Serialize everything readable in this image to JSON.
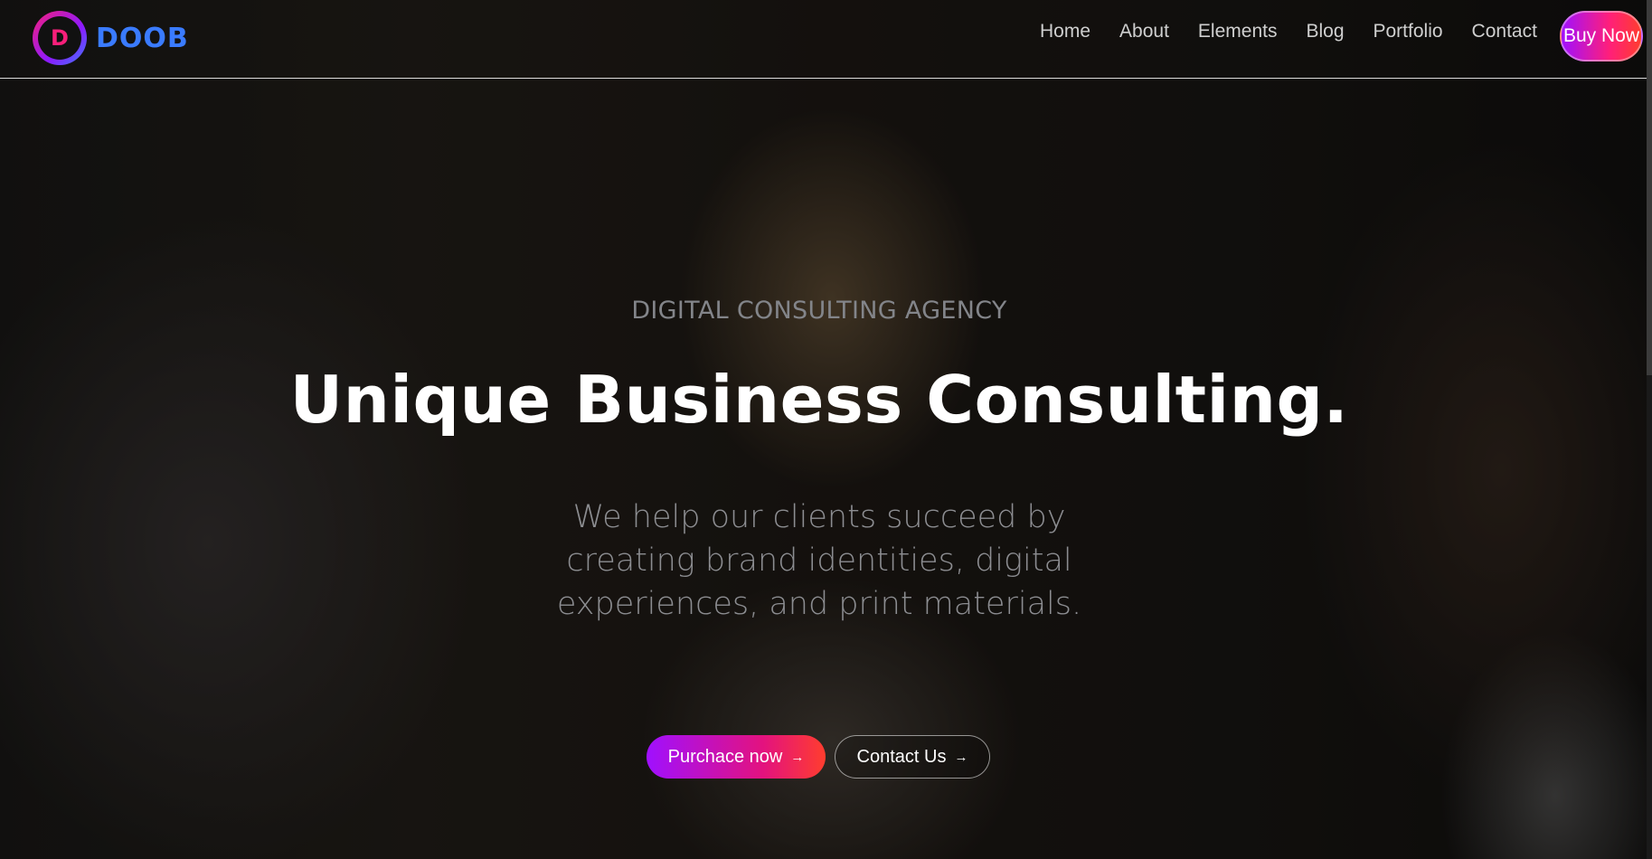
{
  "header": {
    "logo_mark": "D",
    "logo_text": "DOOB",
    "nav": [
      {
        "label": "Home"
      },
      {
        "label": "About"
      },
      {
        "label": "Elements"
      },
      {
        "label": "Blog"
      },
      {
        "label": "Portfolio"
      },
      {
        "label": "Contact"
      }
    ],
    "cta_label": "Buy Now"
  },
  "hero": {
    "subtitle": "DIGITAL CONSULTING AGENCY",
    "title": "Unique Business Consulting.",
    "description": "We help our clients succeed by creating brand identities, digital experiences, and print materials.",
    "primary_button": "Purchace now",
    "secondary_button": "Contact Us",
    "arrow_glyph": "→"
  },
  "colors": {
    "brand_gradient_start": "#a010ff",
    "brand_gradient_end": "#ff3d2e",
    "logo_blue": "#3a7bff",
    "logo_pink": "#f81f7a"
  }
}
